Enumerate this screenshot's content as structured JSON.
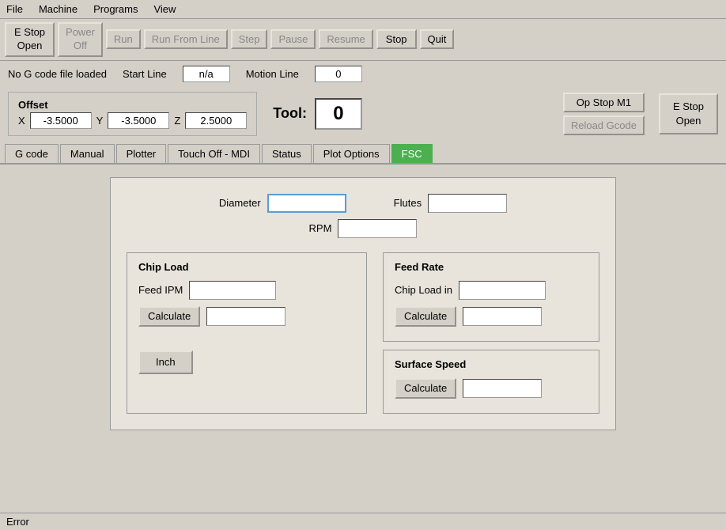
{
  "menubar": {
    "items": [
      "File",
      "Machine",
      "Programs",
      "View"
    ]
  },
  "toolbar": {
    "estop_open_label": "E Stop\nOpen",
    "power_off_label": "Power\nOff",
    "run_label": "Run",
    "run_from_line_label": "Run From Line",
    "step_label": "Step",
    "pause_label": "Pause",
    "resume_label": "Resume",
    "stop_label": "Stop",
    "quit_label": "Quit"
  },
  "inforow": {
    "status_label": "No G code file loaded",
    "start_line_label": "Start Line",
    "start_line_value": "n/a",
    "motion_line_label": "Motion Line",
    "motion_line_value": "0"
  },
  "offset": {
    "title": "Offset",
    "x_label": "X",
    "x_value": "-3.5000",
    "y_label": "Y",
    "y_value": "-3.5000",
    "z_label": "Z",
    "z_value": "2.5000"
  },
  "tool": {
    "label": "Tool:",
    "value": "0"
  },
  "rightbtns": {
    "op_stop_label": "Op Stop M1",
    "reload_gcode_label": "Reload Gcode",
    "estop_open_label": "E Stop\nOpen"
  },
  "tabs": [
    {
      "label": "G code",
      "active": false
    },
    {
      "label": "Manual",
      "active": false
    },
    {
      "label": "Plotter",
      "active": false
    },
    {
      "label": "Touch Off - MDI",
      "active": false
    },
    {
      "label": "Status",
      "active": false
    },
    {
      "label": "Plot Options",
      "active": false
    },
    {
      "label": "FSC",
      "active": true
    }
  ],
  "fsc": {
    "diameter_label": "Diameter",
    "flutes_label": "Flutes",
    "rpm_label": "RPM",
    "chip_load_section": {
      "title": "Chip Load",
      "feed_ipm_label": "Feed IPM",
      "calculate_label": "Calculate"
    },
    "feed_rate_section": {
      "title": "Feed Rate",
      "chip_load_in_label": "Chip Load in",
      "calculate_label": "Calculate"
    },
    "surface_speed_section": {
      "title": "Surface Speed",
      "calculate_label": "Calculate"
    },
    "inch_label": "Inch"
  },
  "statusbar": {
    "text": "Error"
  }
}
